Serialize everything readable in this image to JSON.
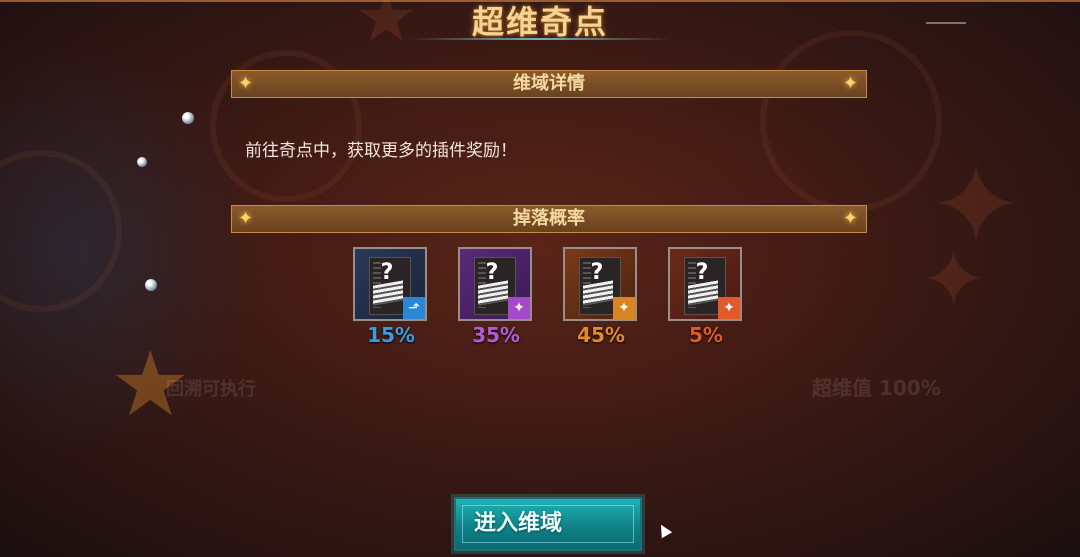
{
  "title": "超维奇点",
  "sections": {
    "details": {
      "label": "维域详情"
    },
    "drop_rates": {
      "label": "掉落概率"
    }
  },
  "description": "前往奇点中，获取更多的插件奖励！",
  "drops": [
    {
      "rate": "15%",
      "color": "#3a9be0",
      "tier_icon": "boot-icon"
    },
    {
      "rate": "35%",
      "color": "#b35ad6",
      "tier_icon": "shuriken-icon"
    },
    {
      "rate": "45%",
      "color": "#e08a2a",
      "tier_icon": "shuriken-icon"
    },
    {
      "rate": "5%",
      "color": "#e25a2a",
      "tier_icon": "shuriken-icon"
    }
  ],
  "enter_button": {
    "label": "进入维域"
  },
  "background_text": {
    "left": "回溯可执行",
    "right": "超维值 100%"
  }
}
